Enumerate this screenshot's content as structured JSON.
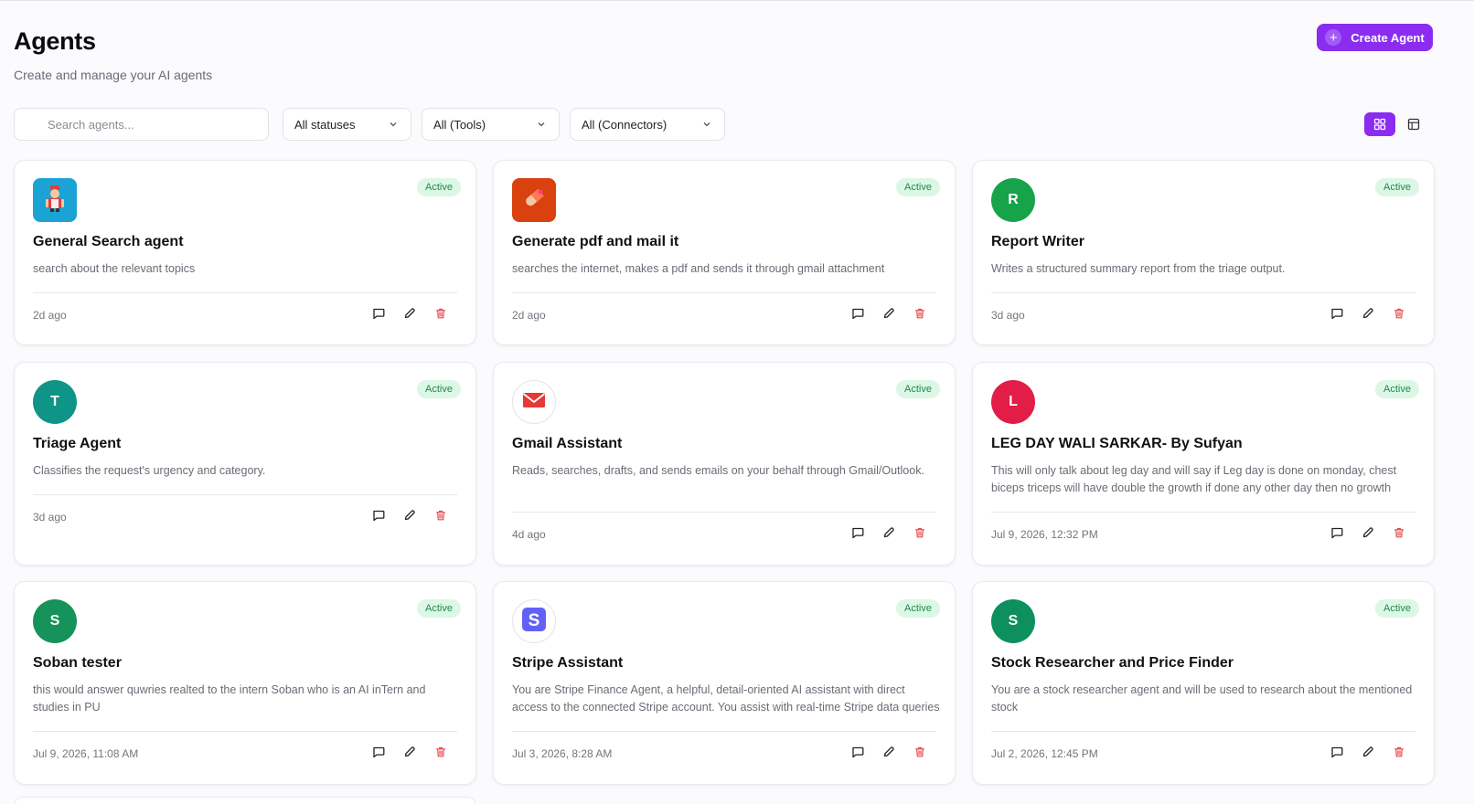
{
  "header": {
    "title": "Agents",
    "subtitle": "Create and manage your AI agents",
    "create_label": "Create Agent"
  },
  "filters": {
    "search_placeholder": "Search agents...",
    "status": "All statuses",
    "tools": "All (Tools)",
    "connectors": "All (Connectors)"
  },
  "colors": {
    "accent": "#8b2cf0",
    "active_badge_bg": "#dcf7e6",
    "active_badge_text": "#1f8a4c",
    "delete_icon": "#e5484d"
  },
  "agents": [
    {
      "name": "General Search agent",
      "description": "search about the relevant topics",
      "status": "Active",
      "time": "2d ago",
      "avatar": {
        "kind": "image",
        "icon": "robot-figure-icon",
        "bg": "#1aa3d4"
      }
    },
    {
      "name": "Generate pdf and mail it",
      "description": "searches the internet, makes a pdf and sends it through gmail attachment",
      "status": "Active",
      "time": "2d ago",
      "avatar": {
        "kind": "image",
        "icon": "pill-icon",
        "bg": "#d9410f"
      }
    },
    {
      "name": "Report Writer",
      "description": "Writes a structured summary report from the triage output.",
      "status": "Active",
      "time": "3d ago",
      "avatar": {
        "kind": "letter",
        "letter": "R",
        "bg": "#16a34a"
      }
    },
    {
      "name": "Triage Agent",
      "description": "Classifies the request's urgency and category.",
      "status": "Active",
      "time": "3d ago",
      "avatar": {
        "kind": "letter",
        "letter": "T",
        "bg": "#0f9488"
      }
    },
    {
      "name": "Gmail Assistant",
      "description": "Reads, searches, drafts, and sends emails on your behalf through Gmail/Outlook.",
      "status": "Active",
      "time": "4d ago",
      "avatar": {
        "kind": "ring",
        "icon": "mail-icon",
        "bg": "#ffffff"
      }
    },
    {
      "name": "LEG DAY WALI SARKAR- By Sufyan",
      "description": "This will only talk about leg day and will say if Leg day is done on monday, chest biceps triceps will have double the growth if done any other day then no growth",
      "status": "Active",
      "time": "Jul 9, 2026, 12:32 PM",
      "avatar": {
        "kind": "letter",
        "letter": "L",
        "bg": "#e11d48"
      }
    },
    {
      "name": "Soban tester",
      "description": "this would answer quwries realted to the intern Soban who is an AI inTern and studies in PU",
      "status": "Active",
      "time": "Jul 9, 2026, 11:08 AM",
      "avatar": {
        "kind": "letter",
        "letter": "S",
        "bg": "#15935a"
      }
    },
    {
      "name": "Stripe Assistant",
      "description": "You are Stripe Finance Agent, a helpful, detail-oriented AI assistant with direct access to the connected Stripe account. You assist with real-time Stripe data queries",
      "status": "Active",
      "time": "Jul 3, 2026, 8:28 AM",
      "avatar": {
        "kind": "ring",
        "icon": "stripe-logo-icon",
        "bg": "#ffffff"
      }
    },
    {
      "name": "Stock Researcher and Price Finder",
      "description": "You are a stock researcher agent and will be used to research about the mentioned stock",
      "status": "Active",
      "time": "Jul 2, 2026, 12:45 PM",
      "avatar": {
        "kind": "letter",
        "letter": "S",
        "bg": "#0e8f5e"
      }
    }
  ]
}
